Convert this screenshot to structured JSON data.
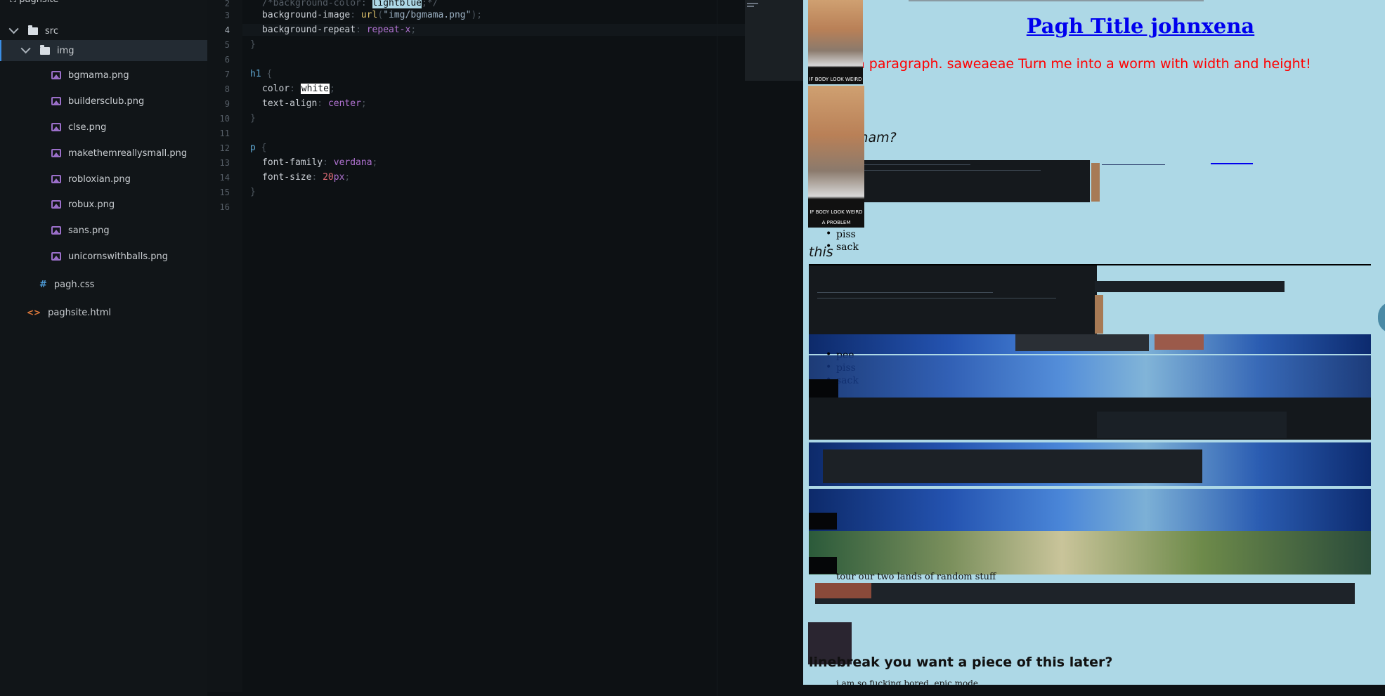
{
  "sidebar": {
    "project": "paghsite",
    "items": [
      {
        "label": "src"
      },
      {
        "label": "img"
      },
      {
        "label": "bgmama.png"
      },
      {
        "label": "buildersclub.png"
      },
      {
        "label": "clse.png"
      },
      {
        "label": "makethemreallysmall.png"
      },
      {
        "label": "robloxian.png"
      },
      {
        "label": "robux.png"
      },
      {
        "label": "sans.png"
      },
      {
        "label": "unicornswithballs.png"
      },
      {
        "label": "pagh.css"
      },
      {
        "label": "paghsite.html"
      }
    ]
  },
  "editor": {
    "line_numbers": [
      "2",
      "3",
      "4",
      "5",
      "6",
      "7",
      "8",
      "9",
      "10",
      "11",
      "12",
      "13",
      "14",
      "15",
      "16"
    ],
    "current_line": "4",
    "code": {
      "l2_a": "/*background-color: ",
      "l2_b": "lightblue",
      "l2_c": ";*/",
      "l3_prop": "background-image",
      "l3_fn": "url",
      "l3_str": "\"img/bgmama.png\"",
      "l4_prop": "background-repeat",
      "l4_val": "repeat-x",
      "l5": "}",
      "l7_sel": "h1",
      "l7_brace": "{",
      "l8_prop": "color",
      "l8_val": "white",
      "l9_prop": "text-align",
      "l9_val": "center",
      "l10": "}",
      "l12_sel": "p",
      "l12_brace": "{",
      "l13_prop": "font-family",
      "l13_val": "verdana",
      "l14_prop": "font-size",
      "l14_num": "20",
      "l14_unit": "px",
      "l15": "}",
      "colon": ": ",
      "semi": ";",
      "paren_open": "(",
      "paren_close": ")"
    }
  },
  "preview": {
    "title": "Pagh Title johnxena",
    "paragraph": "This is a paragraph. saweaeae Turn me into a worm with width and height!",
    "heading_mam": "mam?",
    "heading_this": "this",
    "list1": [
      "piss",
      "sack"
    ],
    "list2": [
      "pee",
      "piss",
      "sack"
    ],
    "scribble_1": "tour our two lands of random stuff",
    "heading_break": "linebreak you want a piece of this later?",
    "scribble_2": "i am so fucking bored. epic mode",
    "photo_caption": "IF BODY LOOK WEIRD",
    "photo_caption_2": "IF BODY LOOK WEIRD",
    "photo_caption_3": "A PROBLEM"
  },
  "colors": {
    "preview_bg": "#add8e6",
    "paragraph": "#ff0000",
    "title_link": "#0000ee",
    "editor_bg": "#0d1114",
    "sidebar_active": "#232b33"
  }
}
